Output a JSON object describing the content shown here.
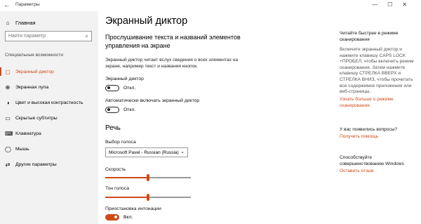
{
  "window": {
    "title": "Параметры",
    "back_icon": "back-arrow-icon",
    "controls": [
      "—",
      "☐",
      "✕"
    ]
  },
  "sidebar": {
    "home_label": "Главная",
    "search_placeholder": "Найти параметр",
    "section_label": "Специальные возможности",
    "items": [
      {
        "label": "Экранный диктор",
        "icon": "narrator-icon",
        "active": true
      },
      {
        "label": "Экранная лупа",
        "icon": "magnifier-icon"
      },
      {
        "label": "Цвет и высокая контрастность",
        "icon": "contrast-icon"
      },
      {
        "label": "Скрытые субтитры",
        "icon": "captions-icon"
      },
      {
        "label": "Клавиатура",
        "icon": "keyboard-icon"
      },
      {
        "label": "Мышь",
        "icon": "mouse-icon"
      },
      {
        "label": "Другие параметры",
        "icon": "other-settings-icon"
      }
    ]
  },
  "main": {
    "title": "Экранный диктор",
    "subheading": "Прослушивание текста и названий элементов управления на экране",
    "description": "Экранный диктор читает вслух сведения о всех элементах на экране, например текст и названия кнопок.",
    "narrator": {
      "label": "Экранный диктор",
      "state": "Откл.",
      "on": false
    },
    "autostart": {
      "label": "Автоматически включать экранный диктор",
      "state": "Откл.",
      "on": false
    },
    "speech_heading": "Речь",
    "voice": {
      "label": "Выбор голоса",
      "value": "Microsoft Pavel - Russian (Russia)"
    },
    "speed": {
      "label": "Скорость",
      "value_fraction": 0.5
    },
    "pitch": {
      "label": "Тон голоса",
      "value_fraction": 0.5
    },
    "intonation": {
      "label": "Приостановка интонации",
      "state": "Вкл.",
      "on": true
    }
  },
  "right": {
    "tip_title": "Читайте быстрее в режиме сканирования",
    "tip_text": "Включите экранный диктор и нажмите клавишу CAPS LOCK +ПРОБЕЛ, чтобы включить режим сканирования. Затем нажмите клавишу СТРЕЛКА ВВЕРХ и СТРЕЛКА ВНИЗ, чтобы прочитать все содержимое приложения или веб-страницы.",
    "tip_link": "Узнать больше о режиме сканирования",
    "question": "У вас появились вопросы?",
    "help_link": "Получить помощь",
    "improve_text": "Способствуйте совершенствованию Windows",
    "feedback_link": "Оставить отзыв"
  }
}
